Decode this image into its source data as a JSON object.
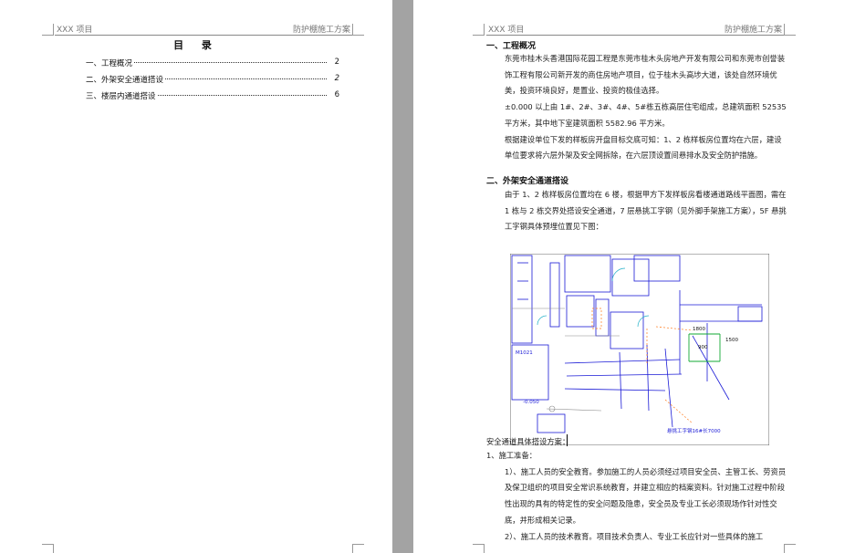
{
  "page1": {
    "header_left": "XXX 项目",
    "header_right": "防护棚施工方案",
    "toc_title": "目 录",
    "toc": [
      {
        "label": "一、工程概况",
        "page": "2"
      },
      {
        "label": "二、外架安全通道搭设",
        "page": "2"
      },
      {
        "label": "三、楼层内通道搭设",
        "page": "6"
      }
    ]
  },
  "page2": {
    "header_left": "XXX 项目",
    "header_right": "防护棚施工方案",
    "section1_title": "一、工程概况",
    "s1_p1": "东莞市桂木头香港国际花园工程是东莞市桂木头房地产开发有限公司和东莞市创誉装饰工程有限公司新开发的商住房地产项目，位于桂木头高埗大道，该处自然环境优美，投资环境良好，是置业、投资的极佳选择。",
    "s1_p2": "±0.000 以上由 1#、2#、3#、4#、5#栋五栋高层住宅组成，总建筑面积 52535 平方米，其中地下室建筑面积 5582.96 平方米。",
    "s1_p3": "根据建设单位下发的样板房开盘目标交底可知：1、2 栋样板房位置均在六层，建设单位要求将六层外架及安全网拆除，在六层顶设置间悬排水及安全防护措施。",
    "section2_title": "二、外架安全通道搭设",
    "s2_p1": "由于 1、2 栋样板房位置均在 6 楼，根据甲方下发样板房看楼通道路线平面图，需在 1 栋与 2 栋交界处搭设安全通道，7 层悬挑工字钢（见外脚手架施工方案），5F 悬挑工字钢具体预埋位置见下图：",
    "caption": "安全通道具体搭设方案：",
    "item1_title": "1、施工准备：",
    "item1_p1": "1）、施工人员的安全教育。参加施工的人员必须经过项目安全员、主管工长、劳资员及保卫组织的项目安全常识系统教育，并建立相应的档案资料。针对施工过程中阶段性出现的具有的特定性的安全问题及隐患，安全员及专业工长必须现场作针对性交底，并形成相关记录。",
    "item1_p2": "2）、施工人员的技术教育。项目技术负责人、专业工长应针对一些具体的施工",
    "drawing_labels": {
      "door": "M1021",
      "level": "-0.050",
      "dim1": "1800",
      "dim2": "1500",
      "dim3": "900",
      "note": "悬挑工字钢16#长7000"
    }
  },
  "colors": {
    "drawing_blue": "#1a1ad6",
    "drawing_cyan": "#22b0c8",
    "drawing_green": "#11aa33",
    "drawing_orange": "#ff7a1a",
    "drawing_grey": "#8a8a8a"
  }
}
